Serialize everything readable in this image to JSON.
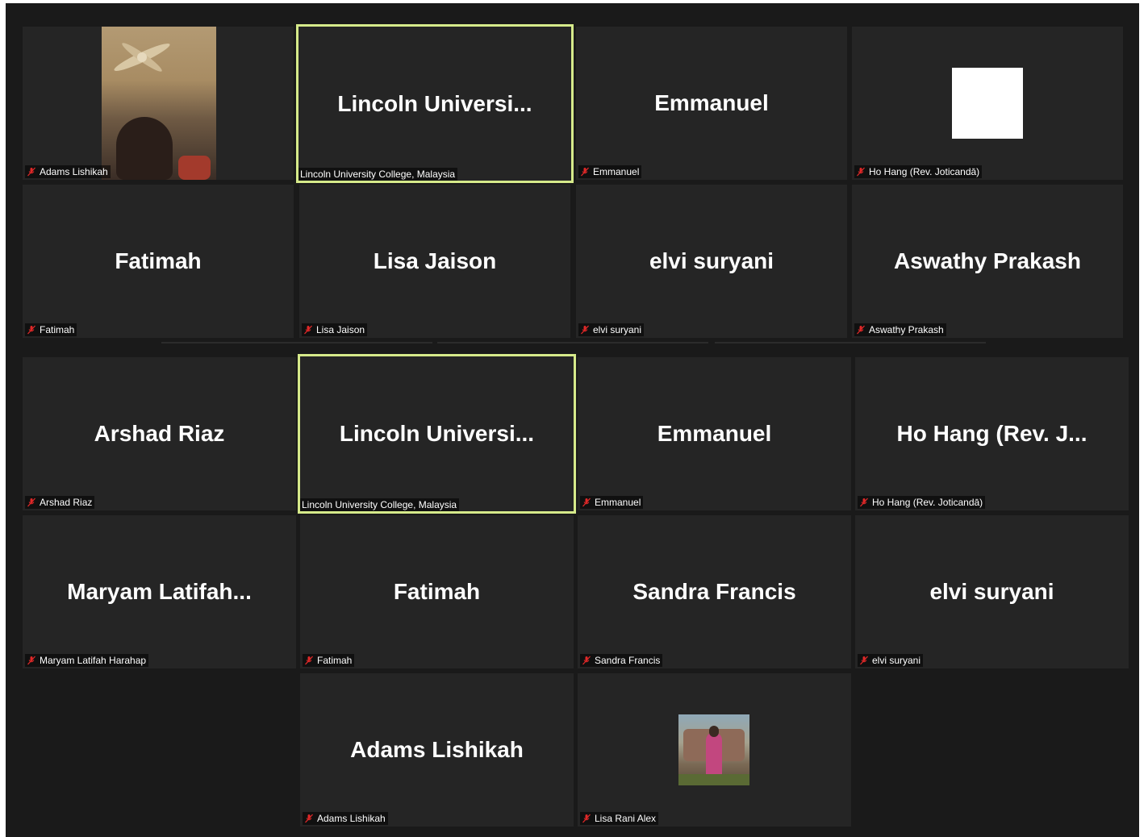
{
  "colors": {
    "background": "#1a1a1a",
    "tile": "#252525",
    "active_speaker_border": "#d6ea8a",
    "muted_icon": "#e02828"
  },
  "top_gallery": {
    "tiles": [
      {
        "display": "",
        "label": "Adams Lishikah",
        "muted": true,
        "type": "video"
      },
      {
        "display": "Lincoln  Universi...",
        "label": "Lincoln University College, Malaysia",
        "muted": false,
        "active": true
      },
      {
        "display": "Emmanuel",
        "label": "Emmanuel",
        "muted": true
      },
      {
        "display": "",
        "label": "Ho Hang (Rev. Joticandā)",
        "muted": true,
        "type": "white-avatar"
      },
      {
        "display": "Fatimah",
        "label": "Fatimah",
        "muted": true
      },
      {
        "display": "Lisa Jaison",
        "label": "Lisa Jaison",
        "muted": true
      },
      {
        "display": "elvi suryani",
        "label": "elvi suryani",
        "muted": true
      },
      {
        "display": "Aswathy Prakash",
        "label": "Aswathy Prakash",
        "muted": true
      }
    ]
  },
  "bottom_gallery": {
    "tiles": [
      {
        "display": "Arshad Riaz",
        "label": "Arshad Riaz",
        "muted": true
      },
      {
        "display": "Lincoln  Universi...",
        "label": "Lincoln University College, Malaysia",
        "muted": false,
        "active": true
      },
      {
        "display": "Emmanuel",
        "label": "Emmanuel",
        "muted": true
      },
      {
        "display": "Ho Hang  (Rev. J...",
        "label": "Ho Hang (Rev. Joticandā)",
        "muted": true
      },
      {
        "display": "Maryam  Latifah...",
        "label": "Maryam Latifah Harahap",
        "muted": true
      },
      {
        "display": "Fatimah",
        "label": "Fatimah",
        "muted": true
      },
      {
        "display": "Sandra Francis",
        "label": "Sandra Francis",
        "muted": true
      },
      {
        "display": "elvi suryani",
        "label": "elvi suryani",
        "muted": true
      },
      {
        "display": "Adams Lishikah",
        "label": "Adams Lishikah",
        "muted": true
      },
      {
        "display": "",
        "label": "Lisa Rani Alex",
        "muted": true,
        "type": "photo-avatar"
      }
    ]
  }
}
